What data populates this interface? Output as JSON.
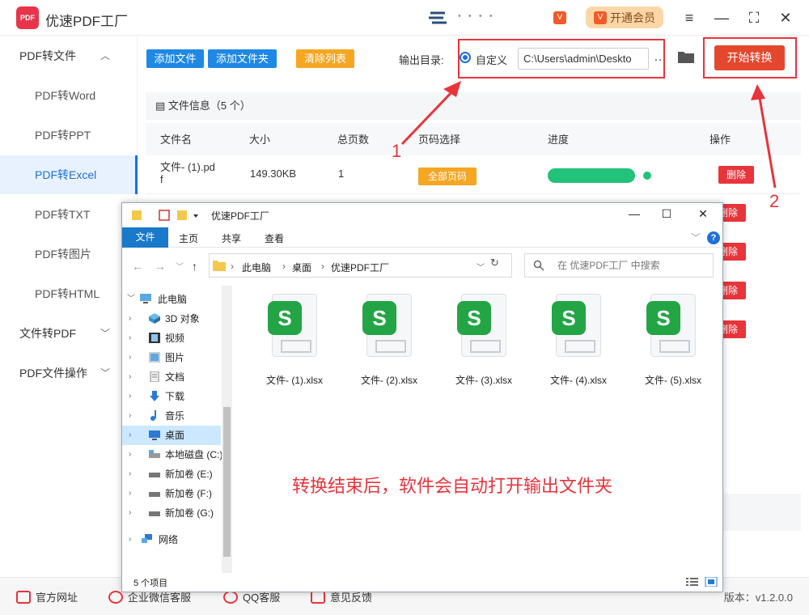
{
  "app": {
    "title": "优速PDF工厂",
    "logo_text": "PDF",
    "user_name": "• • • •",
    "vip_label": "开通会员",
    "vip_icon": "V"
  },
  "sidebar": {
    "groups": [
      {
        "label": "PDF转文件"
      },
      {
        "label": "文件转PDF"
      },
      {
        "label": "PDF文件操作"
      }
    ],
    "items": [
      {
        "label": "PDF转Word"
      },
      {
        "label": "PDF转PPT"
      },
      {
        "label": "PDF转Excel"
      },
      {
        "label": "PDF转TXT"
      },
      {
        "label": "PDF转图片"
      },
      {
        "label": "PDF转HTML"
      }
    ]
  },
  "toolbar": {
    "add_file": "添加文件",
    "add_folder": "添加文件夹",
    "clear_list": "清除列表",
    "output_label": "输出目录:",
    "custom_label": "自定义",
    "output_path": "C:\\Users\\admin\\Deskto",
    "more": "…",
    "start": "开始转换"
  },
  "table": {
    "info": "文件信息（5 个）",
    "headers": [
      "文件名",
      "大小",
      "总页数",
      "页码选择",
      "进度",
      "操作"
    ],
    "rows": [
      {
        "name_l1": "文件- (1).pd",
        "name_l2": "f",
        "size": "149.30KB",
        "pages": "1",
        "page_sel": "全部页码",
        "progress": 1.0,
        "action": "删除"
      }
    ],
    "more_delete": [
      "删除",
      "删除",
      "删除",
      "删除"
    ]
  },
  "explorer": {
    "title": "优速PDF工厂",
    "tabs": [
      "文件",
      "主页",
      "共享",
      "查看"
    ],
    "breadcrumb": [
      "此电脑",
      "桌面",
      "优速PDF工厂"
    ],
    "search_placeholder": "在 优速PDF工厂 中搜索",
    "nav": [
      {
        "label": "此电脑",
        "icon": "computer-icon"
      },
      {
        "label": "3D 对象",
        "icon": "3d-objects-icon"
      },
      {
        "label": "视频",
        "icon": "video-icon"
      },
      {
        "label": "图片",
        "icon": "pictures-icon"
      },
      {
        "label": "文档",
        "icon": "documents-icon"
      },
      {
        "label": "下载",
        "icon": "download-icon"
      },
      {
        "label": "音乐",
        "icon": "music-icon"
      },
      {
        "label": "桌面",
        "icon": "desktop-icon"
      },
      {
        "label": "本地磁盘 (C:)",
        "icon": "drive-icon"
      },
      {
        "label": "新加卷 (E:)",
        "icon": "drive-icon"
      },
      {
        "label": "新加卷 (F:)",
        "icon": "drive-icon"
      },
      {
        "label": "新加卷 (G:)",
        "icon": "drive-icon"
      },
      {
        "label": "网络",
        "icon": "network-icon"
      }
    ],
    "files": [
      "文件- (1).xlsx",
      "文件- (2).xlsx",
      "文件- (3).xlsx",
      "文件- (4).xlsx",
      "文件- (5).xlsx"
    ],
    "file_icon_letter": "S",
    "caption": "转换结束后，软件会自动打开输出文件夹",
    "status": "5 个项目"
  },
  "footer": {
    "website": "官方网址",
    "wechat": "企业微信客服",
    "qq": "QQ客服",
    "feedback": "意见反馈",
    "version": "版本：v1.2.0.0"
  },
  "annotations": {
    "one": "1",
    "two": "2"
  },
  "colors": {
    "accent": "#1e6fd9",
    "danger": "#e8343b",
    "success": "#22c27a",
    "warning": "#f5a623",
    "excel_green": "#23a546"
  }
}
